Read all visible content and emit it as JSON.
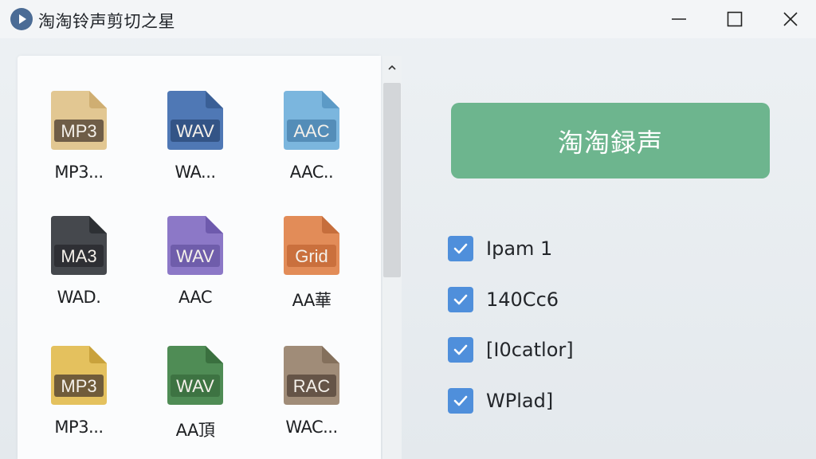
{
  "window": {
    "title": "淘淘铃声剪切之星"
  },
  "files": [
    {
      "badge": "MP3",
      "name": "MP3...",
      "color": "#e2c792",
      "fold": "#cfae72",
      "badge_bg": "#5a4a3a"
    },
    {
      "badge": "WAV",
      "name": "WA...",
      "color": "#4f78b5",
      "fold": "#3a5f96",
      "badge_bg": "#2e4d7e"
    },
    {
      "badge": "AAC",
      "name": "AAC..",
      "color": "#7bb6de",
      "fold": "#5c9ac6",
      "badge_bg": "#4e86b2"
    },
    {
      "badge": "MA3",
      "name": "WAD.",
      "color": "#45484d",
      "fold": "#2d3034",
      "badge_bg": "#2a2c30"
    },
    {
      "badge": "WAV",
      "name": "AAC",
      "color": "#8c78c7",
      "fold": "#6e5aad",
      "badge_bg": "#6a58a6"
    },
    {
      "badge": "Grid",
      "name": "AA華",
      "color": "#e28c58",
      "fold": "#c66e3c",
      "badge_bg": "#c56b38"
    },
    {
      "badge": "MP3",
      "name": "MP3...",
      "color": "#e4c15e",
      "fold": "#c9a23c",
      "badge_bg": "#5c4a34"
    },
    {
      "badge": "WAV",
      "name": "AA頂",
      "color": "#4f8c55",
      "fold": "#3a703f",
      "badge_bg": "#3a6e40"
    },
    {
      "badge": "RAC",
      "name": "WAC...",
      "color": "#a08c78",
      "fold": "#84705c",
      "badge_bg": "#5a4a3e"
    }
  ],
  "action_button": {
    "label": "淘淘録声"
  },
  "options": [
    {
      "label": "Ipam 1",
      "checked": true
    },
    {
      "label": "140Cc6",
      "checked": true
    },
    {
      "label": "[I0catlor]",
      "checked": true
    },
    {
      "label": "WPlad]",
      "checked": true
    }
  ],
  "colors": {
    "accent_green": "#6db58e",
    "checkbox_blue": "#4f8fdb"
  }
}
